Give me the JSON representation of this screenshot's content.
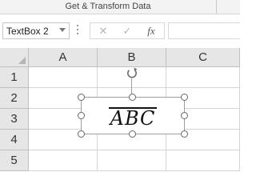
{
  "ribbon": {
    "group_label": "Get & Transform Data"
  },
  "formula_bar": {
    "name_box_value": "TextBox 2",
    "cancel_symbol": "✕",
    "enter_symbol": "✓",
    "fx_label": "fx",
    "formula_value": ""
  },
  "sheet": {
    "columns": [
      "A",
      "B",
      "C"
    ],
    "rows": [
      "1",
      "2",
      "3",
      "4",
      "5"
    ]
  },
  "textbox": {
    "text": "ABC",
    "overline": true
  }
}
